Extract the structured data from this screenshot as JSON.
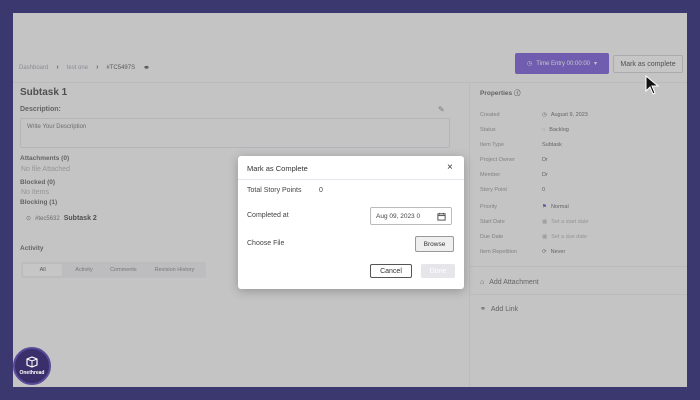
{
  "breadcrumb": {
    "item1": "Dashboard",
    "item2": "test one",
    "item3": "#TC5497S"
  },
  "header": {
    "time_entry_label": "Time Entry 00:00:00",
    "mark_complete_label": "Mark as complete"
  },
  "task": {
    "title": "Subtask 1",
    "description_label": "Description:",
    "description_placeholder": "Write Your Description",
    "attachments_label": "Attachments (0)",
    "attachments_empty": "No file Attached",
    "blocked_label": "Blocked (0)",
    "blocked_empty": "No Items",
    "blocking_label": "Blocking (1)",
    "blocking_item_id": "#tec5632",
    "blocking_item_name": "Subtask 2"
  },
  "activity": {
    "label": "Activity",
    "tabs": [
      "All",
      "Activity",
      "Comments",
      "Revision History"
    ]
  },
  "properties": {
    "title": "Properties",
    "rows": [
      {
        "label": "Created",
        "value": "August 9, 2023"
      },
      {
        "label": "Status",
        "value": "Backlog"
      },
      {
        "label": "Item Type",
        "value": "Subtask"
      },
      {
        "label": "Project Owner",
        "value": "Dr"
      },
      {
        "label": "Member",
        "value": "Dr"
      },
      {
        "label": "Story Point",
        "value": "0"
      },
      {
        "label": "Priority",
        "value": "Normal"
      },
      {
        "label": "Start Date",
        "value": "Set a start date"
      },
      {
        "label": "Due Date",
        "value": "Set a due date"
      },
      {
        "label": "Item Repetition",
        "value": "Never"
      }
    ],
    "add_attachment": "Add Attachment",
    "add_link": "Add Link"
  },
  "modal": {
    "title": "Mark as Complete",
    "story_points_label": "Total Story Points",
    "story_points_value": "0",
    "completed_at_label": "Completed at",
    "completed_at_value": "Aug 09, 2023 0",
    "choose_file_label": "Choose File",
    "browse_label": "Browse",
    "cancel_label": "Cancel",
    "done_label": "Done"
  },
  "logo": {
    "text": "Onethread"
  },
  "colors": {
    "background": "#3b3870",
    "accent": "#6b4bd8",
    "priority_flag": "#3b3bb8"
  }
}
